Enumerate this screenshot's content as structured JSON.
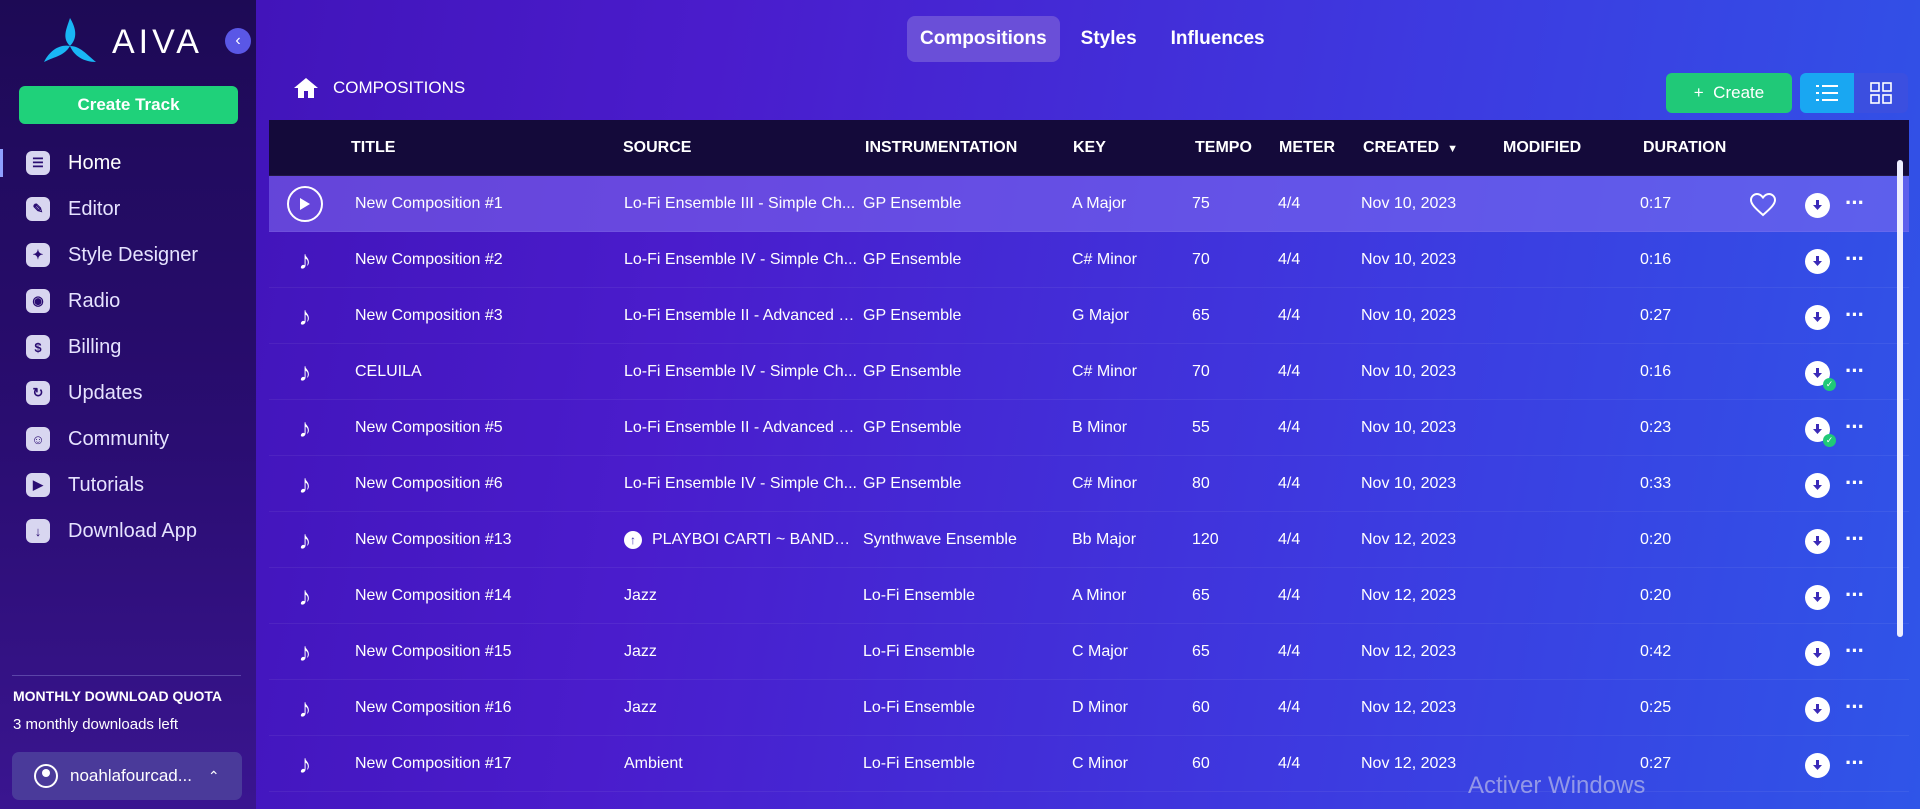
{
  "app": {
    "name": "AIVA",
    "collapse_icon": "chevron-left-icon"
  },
  "sidebar": {
    "create_track_label": "Create Track",
    "items": [
      {
        "label": "Home",
        "icon": "home-icon",
        "glyph": "☰",
        "active": true
      },
      {
        "label": "Editor",
        "icon": "pencil-icon",
        "glyph": "✎"
      },
      {
        "label": "Style Designer",
        "icon": "style-icon",
        "glyph": "✦"
      },
      {
        "label": "Radio",
        "icon": "radio-icon",
        "glyph": "◉"
      },
      {
        "label": "Billing",
        "icon": "dollar-icon",
        "glyph": "$"
      },
      {
        "label": "Updates",
        "icon": "updates-icon",
        "glyph": "↻"
      },
      {
        "label": "Community",
        "icon": "discord-icon",
        "glyph": "☺"
      },
      {
        "label": "Tutorials",
        "icon": "play-icon",
        "glyph": "▶"
      },
      {
        "label": "Download App",
        "icon": "download-app-icon",
        "glyph": "↓"
      }
    ],
    "quota_title": "MONTHLY DOWNLOAD QUOTA",
    "quota_text": "3 monthly downloads left",
    "user_name": "noahlafourcad..."
  },
  "tabs": [
    {
      "label": "Compositions",
      "active": true
    },
    {
      "label": "Styles"
    },
    {
      "label": "Influences"
    }
  ],
  "breadcrumb": "COMPOSITIONS",
  "toolbar": {
    "create_label": "Create",
    "create_plus": "+"
  },
  "table": {
    "headers": {
      "title": "TITLE",
      "source": "SOURCE",
      "instrumentation": "INSTRUMENTATION",
      "key": "KEY",
      "tempo": "TEMPO",
      "meter": "METER",
      "created": "CREATED",
      "modified": "MODIFIED",
      "duration": "DURATION"
    },
    "rows": [
      {
        "title": "New Composition #1",
        "source": "Lo-Fi Ensemble III - Simple Ch...",
        "instrumentation": "GP Ensemble",
        "key": "A Major",
        "tempo": "75",
        "meter": "4/4",
        "created": "Nov 10, 2023",
        "modified": "",
        "duration": "0:17",
        "highlight": true,
        "downloaded": false
      },
      {
        "title": "New Composition #2",
        "source": "Lo-Fi Ensemble IV - Simple Ch...",
        "instrumentation": "GP Ensemble",
        "key": "C# Minor",
        "tempo": "70",
        "meter": "4/4",
        "created": "Nov 10, 2023",
        "modified": "",
        "duration": "0:16",
        "downloaded": false
      },
      {
        "title": "New Composition #3",
        "source": "Lo-Fi Ensemble II - Advanced C...",
        "instrumentation": "GP Ensemble",
        "key": "G Major",
        "tempo": "65",
        "meter": "4/4",
        "created": "Nov 10, 2023",
        "modified": "",
        "duration": "0:27",
        "downloaded": false
      },
      {
        "title": "CELUILA",
        "source": "Lo-Fi Ensemble IV - Simple Ch...",
        "instrumentation": "GP Ensemble",
        "key": "C# Minor",
        "tempo": "70",
        "meter": "4/4",
        "created": "Nov 10, 2023",
        "modified": "",
        "duration": "0:16",
        "downloaded": true
      },
      {
        "title": "New Composition #5",
        "source": "Lo-Fi Ensemble II - Advanced C...",
        "instrumentation": "GP Ensemble",
        "key": "B Minor",
        "tempo": "55",
        "meter": "4/4",
        "created": "Nov 10, 2023",
        "modified": "",
        "duration": "0:23",
        "downloaded": true
      },
      {
        "title": "New Composition #6",
        "source": "Lo-Fi Ensemble IV - Simple Ch...",
        "instrumentation": "GP Ensemble",
        "key": "C# Minor",
        "tempo": "80",
        "meter": "4/4",
        "created": "Nov 10, 2023",
        "modified": "",
        "duration": "0:33",
        "downloaded": false
      },
      {
        "title": "New Composition #13",
        "source": "PLAYBOI CARTI ~ BANDO...",
        "source_upload": true,
        "instrumentation": "Synthwave Ensemble",
        "key": "Bb Major",
        "tempo": "120",
        "meter": "4/4",
        "created": "Nov 12, 2023",
        "modified": "",
        "duration": "0:20",
        "downloaded": false
      },
      {
        "title": "New Composition #14",
        "source": "Jazz",
        "instrumentation": "Lo-Fi Ensemble",
        "key": "A Minor",
        "tempo": "65",
        "meter": "4/4",
        "created": "Nov 12, 2023",
        "modified": "",
        "duration": "0:20",
        "downloaded": false
      },
      {
        "title": "New Composition #15",
        "source": "Jazz",
        "instrumentation": "Lo-Fi Ensemble",
        "key": "C Major",
        "tempo": "65",
        "meter": "4/4",
        "created": "Nov 12, 2023",
        "modified": "",
        "duration": "0:42",
        "downloaded": false
      },
      {
        "title": "New Composition #16",
        "source": "Jazz",
        "instrumentation": "Lo-Fi Ensemble",
        "key": "D Minor",
        "tempo": "60",
        "meter": "4/4",
        "created": "Nov 12, 2023",
        "modified": "",
        "duration": "0:25",
        "downloaded": false
      },
      {
        "title": "New Composition #17",
        "source": "Ambient",
        "instrumentation": "Lo-Fi Ensemble",
        "key": "C Minor",
        "tempo": "60",
        "meter": "4/4",
        "created": "Nov 12, 2023",
        "modified": "",
        "duration": "0:27",
        "downloaded": false
      }
    ]
  },
  "watermark": "Activer Windows",
  "colors": {
    "accent_green": "#1fd17a",
    "sidebar_bg": "#1d0a55",
    "header_bg": "#140a3a",
    "highlight_row": "#7a6af0"
  }
}
